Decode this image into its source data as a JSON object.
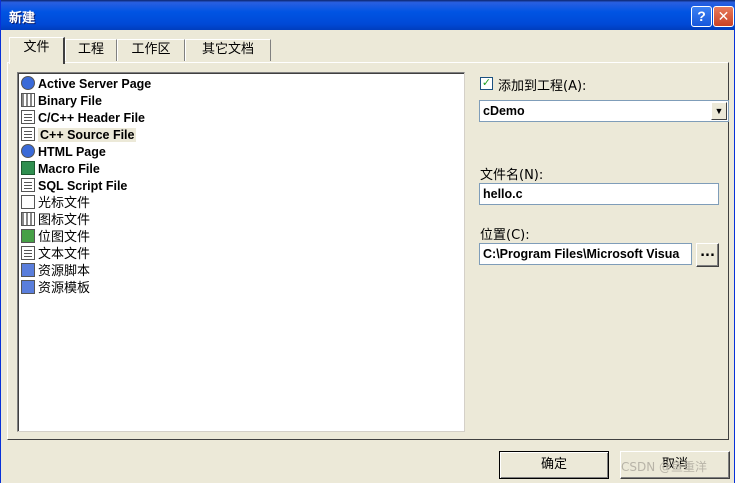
{
  "window": {
    "title": "新建",
    "help_label": "?",
    "close_label": "✕"
  },
  "tabs": [
    {
      "label": "文件",
      "active": true
    },
    {
      "label": "工程",
      "active": false
    },
    {
      "label": "工作区",
      "active": false
    },
    {
      "label": "其它文档",
      "active": false
    }
  ],
  "file_list": {
    "items": [
      {
        "label": "Active Server Page",
        "icon": "asp-file-icon"
      },
      {
        "label": "Binary File",
        "icon": "binary-file-icon"
      },
      {
        "label": "C/C++ Header File",
        "icon": "header-file-icon"
      },
      {
        "label": "C++ Source File",
        "icon": "cpp-file-icon",
        "selected": true
      },
      {
        "label": "HTML Page",
        "icon": "html-file-icon"
      },
      {
        "label": "Macro File",
        "icon": "macro-file-icon"
      },
      {
        "label": "SQL Script File",
        "icon": "sql-file-icon"
      },
      {
        "label": "光标文件",
        "icon": "cursor-file-icon"
      },
      {
        "label": "图标文件",
        "icon": "icon-file-icon"
      },
      {
        "label": "位图文件",
        "icon": "bitmap-file-icon"
      },
      {
        "label": "文本文件",
        "icon": "text-file-icon"
      },
      {
        "label": "资源脚本",
        "icon": "resource-script-icon"
      },
      {
        "label": "资源模板",
        "icon": "resource-template-icon"
      }
    ]
  },
  "add_to_project": {
    "checked": true,
    "check_mark": "✓",
    "label": "添加到工程(A):",
    "selected_value": "cDemo",
    "arrow": "▼"
  },
  "file_name": {
    "label": "文件名(N):",
    "value": "hello.c"
  },
  "location": {
    "label": "位置(C):",
    "value": "C:\\Program Files\\Microsoft Visua",
    "browse_label": "..."
  },
  "buttons": {
    "ok": "确定",
    "cancel": "取消"
  },
  "watermark": "CSDN @鱼重洋"
}
